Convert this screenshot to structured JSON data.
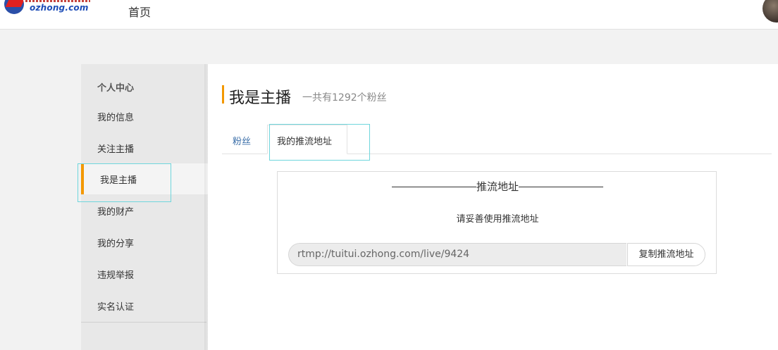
{
  "header": {
    "logo_text": "ozhong.com",
    "nav_home": "首页"
  },
  "sidebar": {
    "title": "个人中心",
    "items": [
      {
        "label": "我的信息"
      },
      {
        "label": "关注主播"
      },
      {
        "label": "我是主播",
        "active": true
      },
      {
        "label": "我的财产"
      },
      {
        "label": "我的分享"
      },
      {
        "label": "违规举报"
      },
      {
        "label": "实名认证"
      }
    ]
  },
  "main": {
    "title": "我是主播",
    "fan_count_text": "一共有1292个粉丝",
    "tabs": [
      {
        "label": "粉丝"
      },
      {
        "label": "我的推流地址",
        "active": true
      }
    ],
    "panel": {
      "heading": "推流地址",
      "tip": "请妥善使用推流地址",
      "url": "rtmp://tuitui.ozhong.com/live/9424",
      "copy_label": "复制推流地址"
    }
  },
  "colors": {
    "accent": "#f39800",
    "link": "#3a6ea8",
    "highlight": "#6fd6dc"
  }
}
